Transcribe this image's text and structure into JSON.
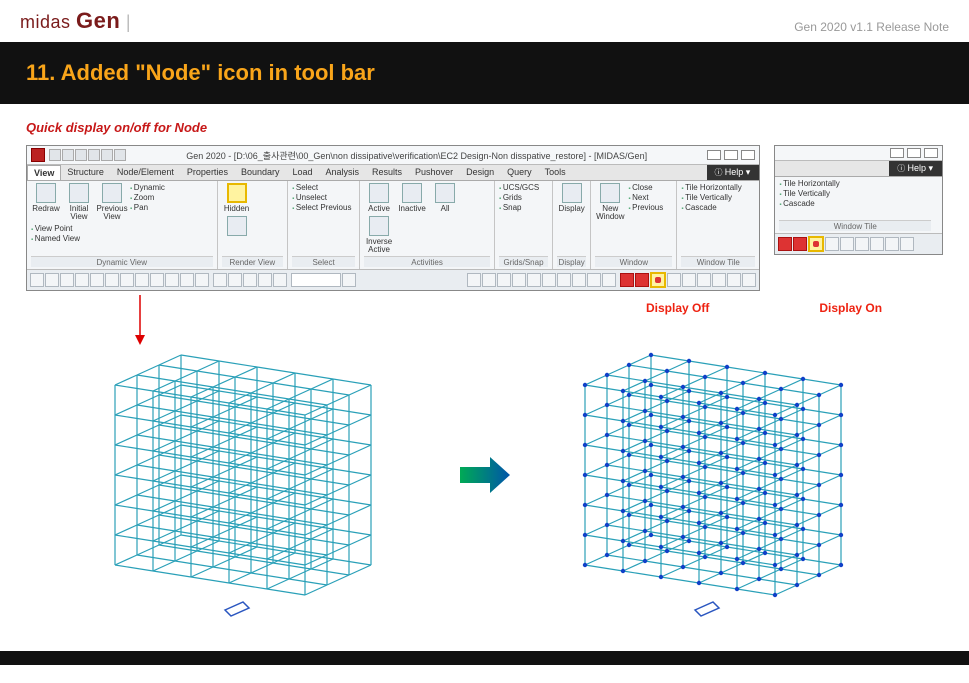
{
  "doc": {
    "brand_prefix": "midas",
    "brand_main": "Gen",
    "release_note": "Gen 2020 v1.1 Release Note",
    "section_title": "11. Added \"Node\" icon in tool bar",
    "subtitle": "Quick display on/off for Node"
  },
  "app": {
    "title": "Gen 2020 - [D:\\06_출사관련\\00_Gen\\non dissipative\\verification\\EC2 Design-Non disspative_restore] - [MIDAS/Gen]",
    "tabs": [
      "View",
      "Structure",
      "Node/Element",
      "Properties",
      "Boundary",
      "Load",
      "Analysis",
      "Results",
      "Pushover",
      "Design",
      "Query",
      "Tools"
    ],
    "help": "Help",
    "groups": {
      "dynamic_view": {
        "label": "Dynamic View",
        "buttons": [
          "Redraw",
          "Initial View",
          "Previous View"
        ],
        "opts": [
          "Dynamic",
          "Zoom",
          "Pan",
          "View Point",
          "Named View"
        ]
      },
      "render_view": {
        "label": "Render View",
        "buttons": [
          "Hidden"
        ]
      },
      "select": {
        "label": "Select",
        "opts": [
          "Select",
          "Unselect",
          "Select Previous"
        ]
      },
      "activities": {
        "label": "Activities",
        "buttons": [
          "Active",
          "Inactive",
          "All",
          "Inverse Active"
        ]
      },
      "grids": {
        "label": "Grids/Snap",
        "opts": [
          "UCS/GCS",
          "Grids",
          "Snap"
        ]
      },
      "display": {
        "label": "Display",
        "buttons": [
          "Display"
        ]
      },
      "window": {
        "label": "Window",
        "buttons": [
          "New Window"
        ],
        "opts": [
          "Close",
          "Next",
          "Previous"
        ]
      },
      "tile": {
        "label": "Window Tile",
        "opts": [
          "Tile Horizontally",
          "Tile Vertically",
          "Cascade"
        ]
      }
    }
  },
  "callouts": {
    "display_off": "Display Off",
    "display_on": "Display On"
  }
}
